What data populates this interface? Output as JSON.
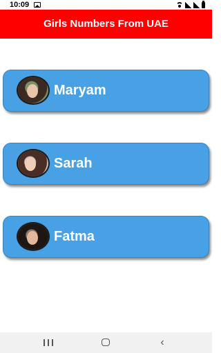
{
  "status_bar": {
    "time": "10:09",
    "icons": [
      "gallery-icon",
      "wifi-icon",
      "signal-icon",
      "battery-icon"
    ]
  },
  "app_bar": {
    "title": "Girls Numbers From UAE",
    "background": "#ff0000"
  },
  "contacts": [
    {
      "name": "Maryam",
      "avatar": "avatar-photo"
    },
    {
      "name": "Sarah",
      "avatar": "avatar-photo"
    },
    {
      "name": "Fatma",
      "avatar": "avatar-photo"
    }
  ],
  "colors": {
    "card": "#48a1e4",
    "title_bar": "#ff0000",
    "text_on_color": "#ffffff"
  },
  "nav_bar": {
    "buttons": [
      "recents-icon",
      "home-icon",
      "back-icon"
    ],
    "back_glyph": "‹"
  }
}
